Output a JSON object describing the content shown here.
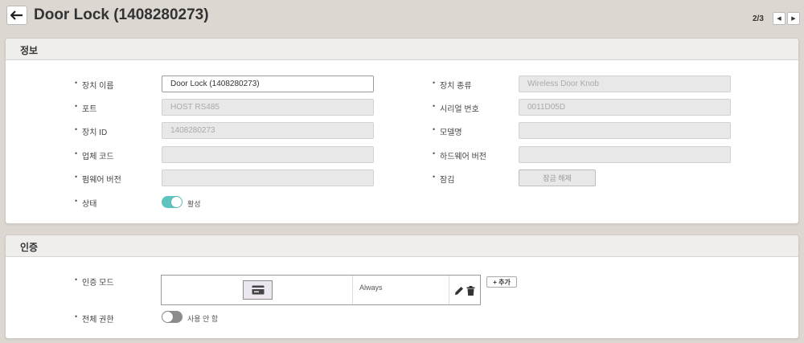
{
  "header": {
    "title": "Door Lock (1408280273)",
    "pager": "2/3",
    "pager_prev_icon": "◀",
    "pager_next_icon": "▶"
  },
  "info": {
    "heading": "정보",
    "device_name_label": "장치 이름",
    "device_name_value": "Door Lock (1408280273)",
    "port_label": "포트",
    "port_value": "HOST RS485",
    "device_id_label": "장치 ID",
    "device_id_value": "1408280273",
    "vendor_code_label": "업체 코드",
    "vendor_code_value": "",
    "firmware_label": "펌웨어 버전",
    "firmware_value": "",
    "status_label": "상태",
    "status_toggle_text": "활성",
    "device_type_label": "장치 종류",
    "device_type_value": "Wireless Door Knob",
    "serial_label": "시리얼 번호",
    "serial_value": "0011D05D",
    "model_label": "모델명",
    "model_value": "",
    "hardware_label": "하드웨어 버전",
    "hardware_value": "",
    "lock_label": "잠김",
    "unlock_button": "잠금 해제"
  },
  "auth": {
    "heading": "인증",
    "mode_label": "인증 모드",
    "schedule_text": "Always",
    "add_button": "+ 추가",
    "full_access_label": "전체 권한",
    "full_access_toggle_text": "사용 안 함"
  },
  "colors": {
    "toggle_on": "#5fc3bf",
    "toggle_off": "#8c8c8c",
    "background": "#ddd7d2"
  }
}
